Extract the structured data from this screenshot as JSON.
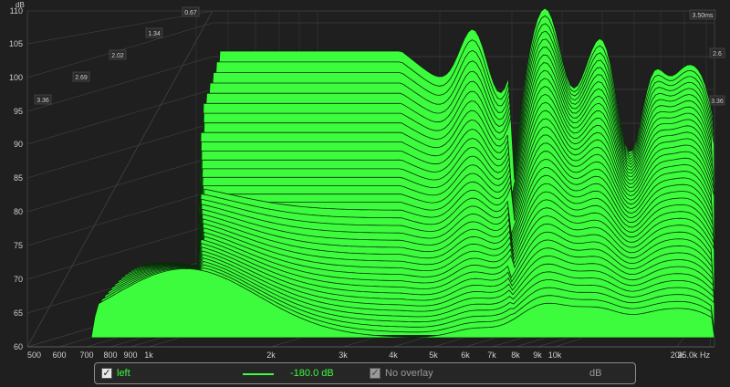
{
  "plot": {
    "y_unit": "dB",
    "y_ticks": [
      "110",
      "105",
      "100",
      "95",
      "90",
      "85",
      "80",
      "75",
      "70",
      "65",
      "60"
    ],
    "x_ticks": [
      "500",
      "600",
      "700",
      "800",
      "900",
      "1k",
      "2k",
      "3k",
      "4k",
      "5k",
      "6k",
      "7k",
      "8k",
      "9k",
      "10k",
      "20k",
      "25.0k Hz"
    ],
    "time_ticks_left": [
      "0.67",
      "1.34",
      "2.02",
      "2.69",
      "3.36"
    ],
    "time_ticks_right": [
      "3.50ms",
      "2.6",
      "3.36"
    ],
    "colors": {
      "surface": "#3dfc3d",
      "ridge_line": "#0a2a0a",
      "grid": "#3c3c3c",
      "background": "#1f1f1f"
    }
  },
  "legend": {
    "trace_name": "left",
    "trace_value": "-180.0 dB",
    "overlay_label": "No overlay",
    "unit": "dB"
  }
}
